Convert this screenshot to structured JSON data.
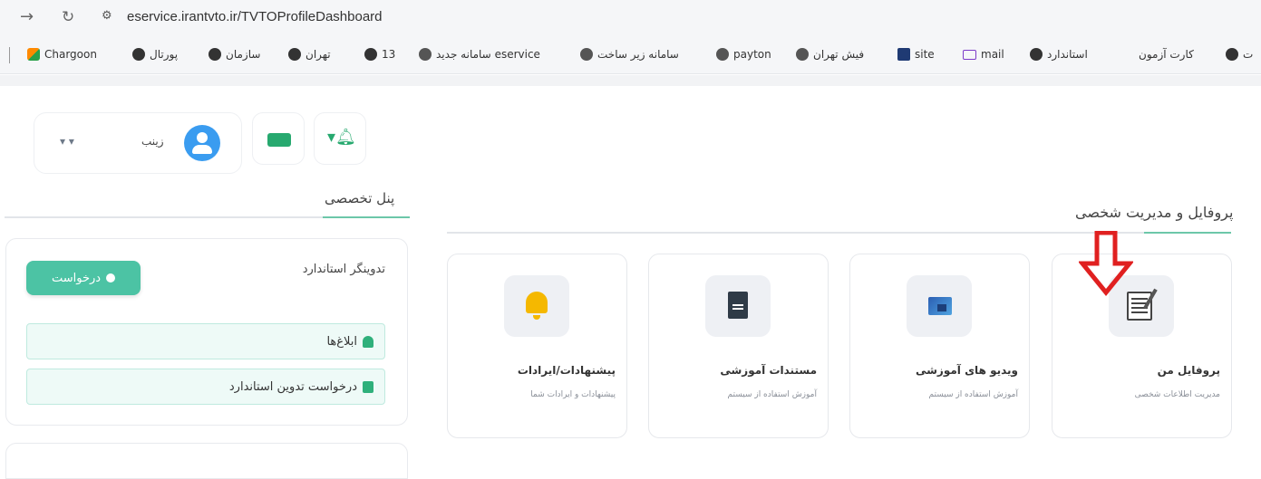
{
  "browser": {
    "url": "eservice.irantvto.ir/TVTOProfileDashboard",
    "bookmarks": [
      {
        "label": "کارت آزمون",
        "icon": "gray-circle-icon"
      },
      {
        "label": "استاندارد",
        "icon": "gray-circle-icon"
      },
      {
        "label": "mail",
        "icon": "mail-icon"
      },
      {
        "label": "site",
        "icon": "site-icon"
      },
      {
        "label": "فیش تهران",
        "icon": "globe-icon"
      },
      {
        "label": "payton",
        "icon": "payton-icon"
      },
      {
        "label": "سامانه زیر ساخت",
        "icon": "globe-icon"
      },
      {
        "label": "سامانه جدید eservice",
        "icon": "globe-icon"
      },
      {
        "label": "13",
        "icon": "gray-circle-icon"
      },
      {
        "label": "تهران",
        "icon": "gray-circle-icon"
      },
      {
        "label": "سازمان",
        "icon": "gray-circle-icon"
      },
      {
        "label": "پورتال",
        "icon": "gray-circle-icon"
      },
      {
        "label": "Chargoon",
        "icon": "chargoon-logo-icon"
      }
    ],
    "overflow_label": "ت"
  },
  "header": {
    "user_name": "زینب",
    "user_dropdown": "▾ ▾"
  },
  "panel": {
    "title": "پنل تخصصی",
    "card_title": "تدوینگر استاندارد",
    "request_button": "درخواست",
    "items": [
      {
        "label": "ابلاغ‌ها",
        "icon": "bell-icon"
      },
      {
        "label": "درخواست تدوین استاندارد",
        "icon": "file-icon"
      }
    ]
  },
  "main": {
    "title": "پروفایل و مدیریت شخصی",
    "cards": [
      {
        "title": "پروفایل من",
        "subtitle": "مدیریت اطلاعات شخصی",
        "icon": "profile-form-icon"
      },
      {
        "title": "ویدیو های آموزشی",
        "subtitle": "آموزش استفاده از سیستم",
        "icon": "video-icon"
      },
      {
        "title": "مستندات آموزشی",
        "subtitle": "آموزش استفاده از سیستم",
        "icon": "document-icon"
      },
      {
        "title": "پیشنهادات/ایرادات",
        "subtitle": "پیشنهادات و ایرادات شما",
        "icon": "bell-icon"
      }
    ]
  },
  "colors": {
    "accent_green": "#4cc3a4",
    "arrow_red": "#e02020",
    "avatar_blue": "#3a9cf0"
  }
}
